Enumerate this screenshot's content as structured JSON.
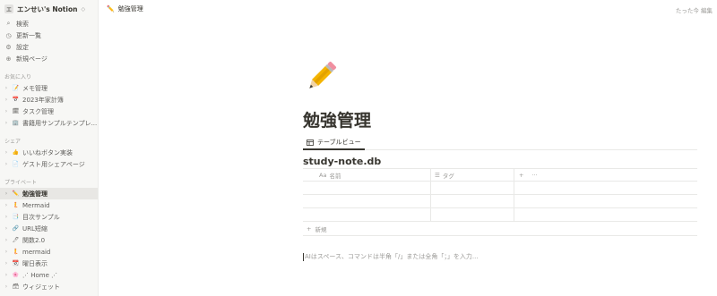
{
  "sidebar": {
    "workspace": {
      "avatar": "エ",
      "name": "エンせい's Notion",
      "caret": "◇"
    },
    "nav": [
      {
        "icon": "search-icon",
        "glyph": "⌕",
        "label": "検索"
      },
      {
        "icon": "clock-icon",
        "glyph": "◷",
        "label": "更新一覧"
      },
      {
        "icon": "gear-icon",
        "glyph": "⚙",
        "label": "設定"
      },
      {
        "icon": "plus-circle-icon",
        "glyph": "⊕",
        "label": "新規ページ"
      }
    ],
    "sections": {
      "favorites": "お気に入り",
      "shared": "シェア",
      "private": "プライベート"
    },
    "favorites": [
      {
        "emoji": "📝",
        "label": "メモ管理"
      },
      {
        "emoji": "📅",
        "label": "2023年家計簿"
      },
      {
        "emoji": "🗓",
        "label": "タスク管理"
      },
      {
        "emoji": "🏢",
        "label": "書籍用サンプルテンプレ..."
      }
    ],
    "shared": [
      {
        "emoji": "👍",
        "label": "いいねボタン実装"
      },
      {
        "emoji": "📄",
        "label": "ゲスト用シェアページ"
      }
    ],
    "private": [
      {
        "emoji": "✏️",
        "label": "勉強管理",
        "active": true
      },
      {
        "emoji": "🧜",
        "label": "Mermaid"
      },
      {
        "emoji": "📑",
        "label": "目次サンプル"
      },
      {
        "emoji": "🔗",
        "label": "URL短縮"
      },
      {
        "emoji": "🖊",
        "label": "関数2.0"
      },
      {
        "emoji": "🧜",
        "label": "mermaid"
      },
      {
        "emoji": "📆",
        "label": "曜日表示"
      },
      {
        "emoji": "🌸",
        "label": "⋰ Home ⋰"
      },
      {
        "emoji": "🗃",
        "label": "ウィジェット"
      }
    ]
  },
  "topbar": {
    "breadcrumb_emoji": "✏️",
    "breadcrumb": "勉強管理",
    "edited": "たった今 編集"
  },
  "page": {
    "title": "勉強管理",
    "view_tab": "テーブルビュー",
    "db_title": "study-note.db",
    "columns": [
      {
        "icon": "Aa",
        "label": "名前"
      },
      {
        "icon": "☰",
        "label": "タグ"
      }
    ],
    "add_column": "+",
    "more": "···",
    "new_row": "新規",
    "placeholder": "AIはスペース、コマンドは半角「/」または全角「；」を入力..."
  }
}
